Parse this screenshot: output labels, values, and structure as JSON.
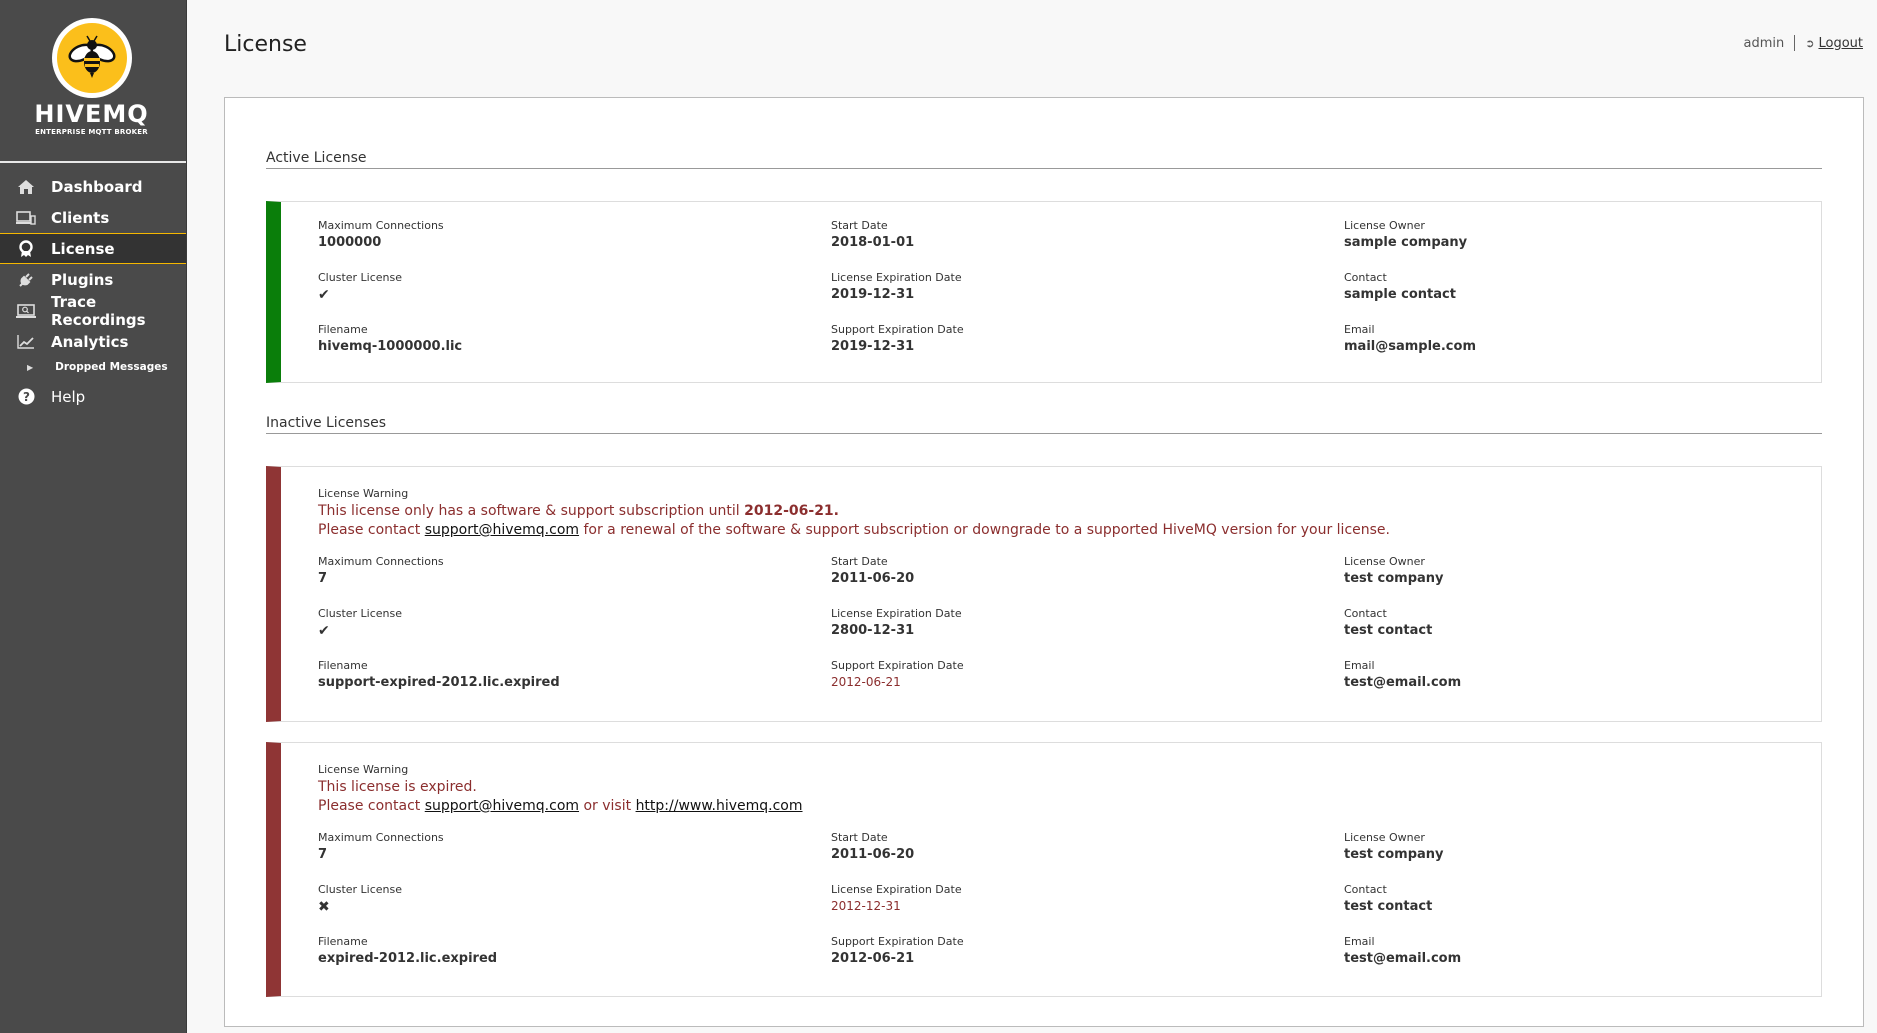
{
  "brand": {
    "name": "HIVEMQ",
    "tagline": "ENTERPRISE MQTT BROKER",
    "accent": "#fbbf1b"
  },
  "sidebar": {
    "items": [
      {
        "label": "Dashboard",
        "icon": "home-icon",
        "active": false
      },
      {
        "label": "Clients",
        "icon": "devices-icon",
        "active": false
      },
      {
        "label": "License",
        "icon": "award-icon",
        "active": true
      },
      {
        "label": "Plugins",
        "icon": "plug-icon",
        "active": false
      },
      {
        "label": "Trace Recordings",
        "icon": "laptop-search-icon",
        "active": false
      },
      {
        "label": "Analytics",
        "icon": "line-chart-icon",
        "active": false
      }
    ],
    "sub_items": [
      {
        "label": "Dropped Messages",
        "icon": "caret-right-icon"
      }
    ],
    "help": {
      "label": "Help",
      "icon": "question-circle-icon"
    }
  },
  "header": {
    "title": "License",
    "user": "admin",
    "logout_label": "Logout"
  },
  "colors": {
    "active_bar": "#0a7e0a",
    "inactive_bar": "#8f3535",
    "warning_text": "#8b2e2e"
  },
  "labels": {
    "max_connections": "Maximum Connections",
    "cluster_license": "Cluster License",
    "filename": "Filename",
    "start_date": "Start Date",
    "license_expiration": "License Expiration Date",
    "support_expiration": "Support Expiration Date",
    "license_owner": "License Owner",
    "contact": "Contact",
    "email": "Email",
    "license_warning": "License Warning"
  },
  "active_section": {
    "title": "Active License",
    "license": {
      "max_connections": "1000000",
      "cluster_license": "check",
      "filename": "hivemq-1000000.lic",
      "start_date": "2018-01-01",
      "license_expiration": "2019-12-31",
      "support_expiration": "2019-12-31",
      "license_owner": "sample company",
      "contact": "sample contact",
      "email": "mail@sample.com"
    }
  },
  "inactive_section": {
    "title": "Inactive Licenses",
    "licenses": [
      {
        "warning": {
          "line1_prefix": "This license only has a software & support subscription until ",
          "line1_bold": "2012-06-21.",
          "line2_prefix": "Please contact ",
          "line2_link": "support@hivemq.com",
          "line2_suffix": " for a renewal of the software & support subscription or downgrade to a supported HiveMQ version for your license."
        },
        "max_connections": "7",
        "cluster_license": "check",
        "filename": "support-expired-2012.lic.expired",
        "start_date": "2011-06-20",
        "license_expiration": "2800-12-31",
        "support_expiration": "2012-06-21",
        "license_owner": "test company",
        "contact": "test contact",
        "email": "test@email.com"
      },
      {
        "warning": {
          "line1": "This license is expired.",
          "line2_prefix": "Please contact ",
          "line2_link": "support@hivemq.com",
          "line2_middle": " or visit ",
          "line2_link2": "http://www.hivemq.com"
        },
        "max_connections": "7",
        "cluster_license": "cross",
        "filename": "expired-2012.lic.expired",
        "start_date": "2011-06-20",
        "license_expiration": "2012-12-31",
        "support_expiration": "2012-06-21",
        "license_owner": "test company",
        "contact": "test contact",
        "email": "test@email.com"
      }
    ]
  }
}
